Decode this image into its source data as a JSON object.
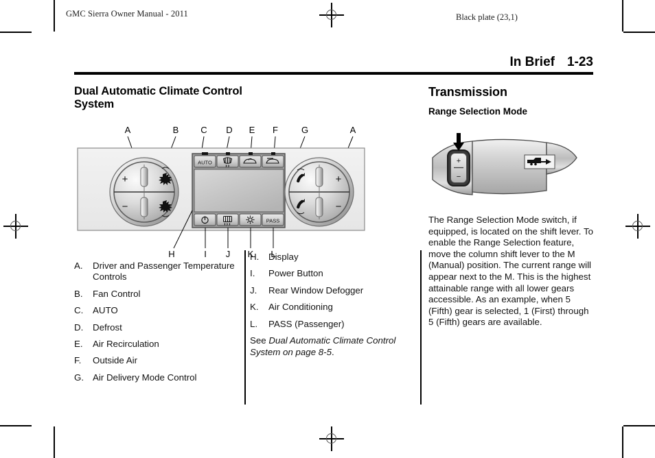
{
  "header": {
    "manual_title": "GMC Sierra Owner Manual - 2011",
    "plate_note": "Black plate (23,1)",
    "section": "In Brief",
    "page_number": "1-23"
  },
  "left_column": {
    "heading": "Dual Automatic Climate Control System",
    "figure": {
      "name": "dual-automatic-climate-control-panel",
      "callouts_top": [
        "A",
        "B",
        "C",
        "D",
        "E",
        "F",
        "G",
        "A"
      ],
      "callouts_bottom": [
        "H",
        "I",
        "J",
        "K",
        "L"
      ],
      "buttons_top": [
        "AUTO",
        "defrost-icon",
        "air-recirculation-icon",
        "outside-air-icon"
      ],
      "buttons_bottom": [
        "power-icon",
        "rear-defogger-icon",
        "air-conditioning-icon",
        "PASS"
      ],
      "knob_left_marks": [
        "+",
        "−",
        "fan-up-icon",
        "fan-down-icon"
      ],
      "knob_right_marks": [
        "+",
        "−",
        "mode-up-icon",
        "mode-down-icon"
      ]
    },
    "legend": [
      {
        "letter": "A.",
        "text": "Driver and Passenger Temperature Controls"
      },
      {
        "letter": "B.",
        "text": "Fan Control"
      },
      {
        "letter": "C.",
        "text": "AUTO"
      },
      {
        "letter": "D.",
        "text": "Defrost"
      },
      {
        "letter": "E.",
        "text": "Air Recirculation"
      },
      {
        "letter": "F.",
        "text": "Outside Air"
      },
      {
        "letter": "G.",
        "text": "Air Delivery Mode Control"
      }
    ]
  },
  "middle_column": {
    "legend": [
      {
        "letter": "H.",
        "text": "Display"
      },
      {
        "letter": "I.",
        "text": "Power Button"
      },
      {
        "letter": "J.",
        "text": "Rear Window Defogger"
      },
      {
        "letter": "K.",
        "text": "Air Conditioning"
      },
      {
        "letter": "L.",
        "text": "PASS (Passenger)"
      }
    ],
    "see_reference": {
      "prefix": "See ",
      "italic": "Dual Automatic Climate Control System on page 8‑5",
      "suffix": "."
    }
  },
  "right_column": {
    "heading": "Transmission",
    "subheading": "Range Selection Mode",
    "figure": {
      "name": "range-selection-mode-shift-lever",
      "switch_marks": [
        "+",
        "−"
      ],
      "badge": "tow-haul-icon",
      "pointer": "down-arrow-icon"
    },
    "body": "The Range Selection Mode switch, if equipped, is located on the shift lever. To enable the Range Selection feature, move the column shift lever to the M (Manual) position. The current range will appear next to the M. This is the highest attainable range with all lower gears accessible. As an example, when 5 (Fifth) gear is selected, 1 (First) through 5 (Fifth) gears are available."
  },
  "colors": {
    "ink": "#000000",
    "body_text": "#111111",
    "rule": "#000000",
    "figure_outline": "#2b2b2b",
    "figure_fill_light": "#f0f0f0",
    "figure_fill_mid": "#cfcfcf"
  }
}
